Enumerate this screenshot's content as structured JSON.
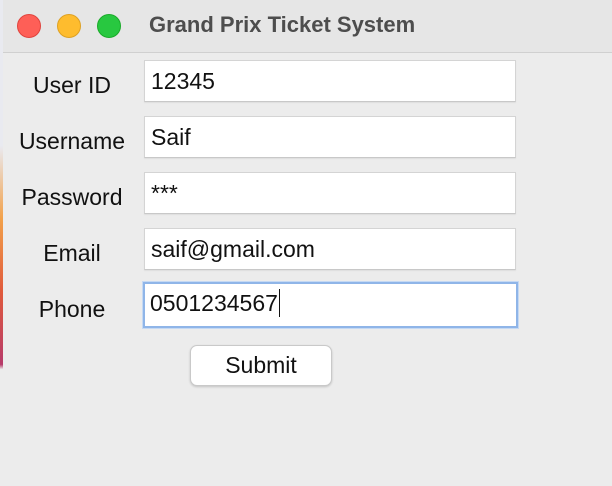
{
  "window": {
    "title": "Grand Prix Ticket System"
  },
  "form": {
    "fields": [
      {
        "label": "User ID",
        "value": "12345"
      },
      {
        "label": "Username",
        "value": "Saif"
      },
      {
        "label": "Password",
        "value": "***"
      },
      {
        "label": "Email",
        "value": "saif@gmail.com"
      },
      {
        "label": "Phone",
        "value": "0501234567"
      }
    ],
    "focused_field": "Phone",
    "submit_label": "Submit"
  },
  "colors": {
    "close": "#fe5f57",
    "minimize": "#febc2e",
    "maximize": "#28c840",
    "focus_ring": "#8fb5e8"
  }
}
